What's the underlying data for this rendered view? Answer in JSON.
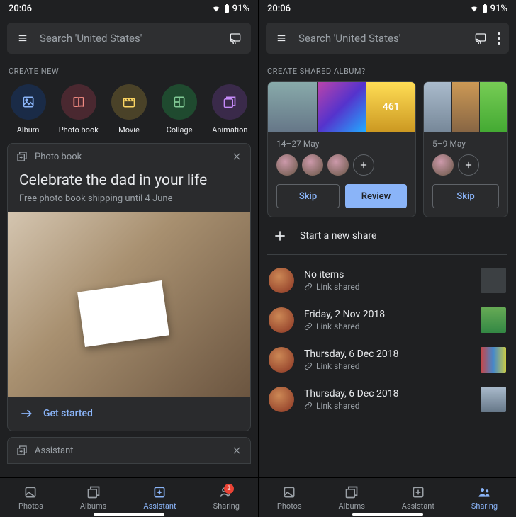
{
  "status": {
    "time": "20:06",
    "battery": "91%"
  },
  "search": {
    "placeholder": "Search 'United States'"
  },
  "left": {
    "create_label": "CREATE NEW",
    "items": [
      {
        "label": "Album"
      },
      {
        "label": "Photo book"
      },
      {
        "label": "Movie"
      },
      {
        "label": "Collage"
      },
      {
        "label": "Animation"
      }
    ],
    "card": {
      "header": "Photo book",
      "title": "Celebrate the dad in your life",
      "subtitle": "Free photo book shipping until 4 June",
      "cta": "Get started"
    },
    "peek": "Assistant",
    "nav": {
      "photos": "Photos",
      "albums": "Albums",
      "assistant": "Assistant",
      "sharing": "Sharing",
      "badge": "2"
    }
  },
  "right": {
    "create_label": "CREATE SHARED ALBUM?",
    "albums": [
      {
        "date": "14–27 May",
        "overflow": "461",
        "skip": "Skip",
        "review": "Review"
      },
      {
        "date": "5–9 May",
        "skip": "Skip"
      }
    ],
    "start_share": "Start a new share",
    "shares": [
      {
        "title": "No items",
        "sub": "Link shared"
      },
      {
        "title": "Friday, 2 Nov 2018",
        "sub": "Link shared"
      },
      {
        "title": "Thursday, 6 Dec 2018",
        "sub": "Link shared"
      },
      {
        "title": "Thursday, 6 Dec 2018",
        "sub": "Link shared"
      }
    ],
    "nav": {
      "photos": "Photos",
      "albums": "Albums",
      "assistant": "Assistant",
      "sharing": "Sharing"
    }
  }
}
